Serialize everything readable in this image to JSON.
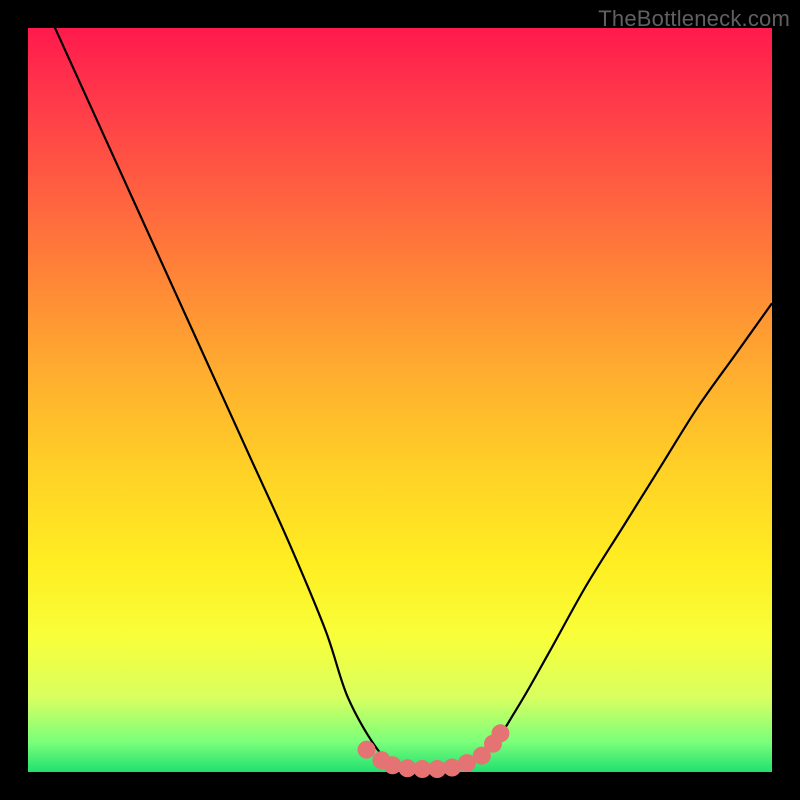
{
  "watermark": "TheBottleneck.com",
  "colors": {
    "frame": "#000000",
    "curve_stroke": "#000000",
    "marker_fill": "#e57373",
    "gradient_top": "#ff1a4d",
    "gradient_bottom": "#20e070"
  },
  "chart_data": {
    "type": "line",
    "title": "",
    "xlabel": "",
    "ylabel": "",
    "xlim": [
      0,
      100
    ],
    "ylim": [
      0,
      100
    ],
    "legend": null,
    "grid": false,
    "series": [
      {
        "name": "bottleneck-curve",
        "x": [
          0,
          5,
          10,
          15,
          20,
          25,
          30,
          35,
          40,
          43,
          47,
          50,
          55,
          58,
          62,
          66,
          70,
          75,
          80,
          85,
          90,
          95,
          100
        ],
        "y": [
          108,
          97,
          86,
          75,
          64,
          53,
          42,
          31,
          19,
          10,
          3,
          0.5,
          0,
          0.5,
          3,
          9,
          16,
          25,
          33,
          41,
          49,
          56,
          63
        ]
      }
    ],
    "markers": [
      {
        "x": 45.5,
        "y": 3.0
      },
      {
        "x": 47.5,
        "y": 1.6
      },
      {
        "x": 49.0,
        "y": 0.9
      },
      {
        "x": 51.0,
        "y": 0.5
      },
      {
        "x": 53.0,
        "y": 0.4
      },
      {
        "x": 55.0,
        "y": 0.4
      },
      {
        "x": 57.0,
        "y": 0.6
      },
      {
        "x": 59.0,
        "y": 1.2
      },
      {
        "x": 61.0,
        "y": 2.2
      },
      {
        "x": 62.5,
        "y": 3.8
      },
      {
        "x": 63.5,
        "y": 5.2
      }
    ]
  }
}
